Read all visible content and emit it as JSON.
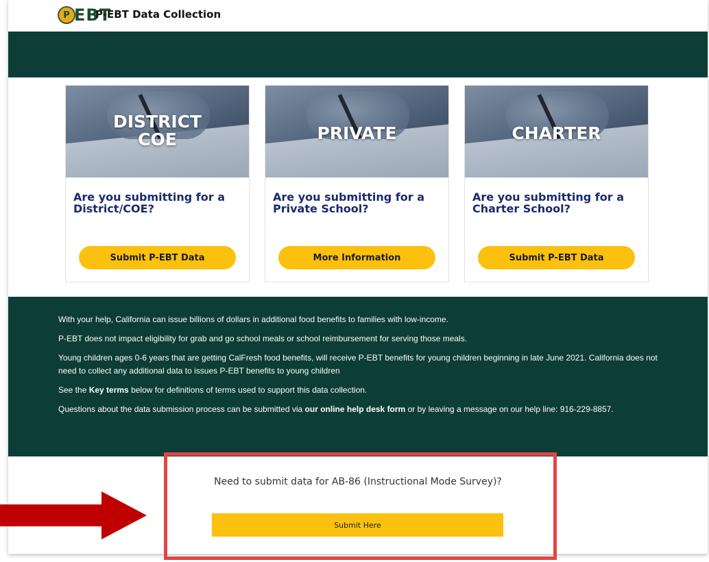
{
  "header": {
    "logo_seal": "P",
    "logo_text": "EBT",
    "title": "P-EBT Data Collection"
  },
  "cards": [
    {
      "image_label_line1": "DISTRICT",
      "image_label_line2": "COE",
      "question": "Are you submitting for a District/COE?",
      "button": "Submit P-EBT Data"
    },
    {
      "image_label_line1": "PRIVATE",
      "image_label_line2": "",
      "question": "Are you submitting for a Private School?",
      "button": "More Information"
    },
    {
      "image_label_line1": "CHARTER",
      "image_label_line2": "",
      "question": "Are you submitting for a Charter School?",
      "button": "Submit P-EBT Data"
    }
  ],
  "info": {
    "p1": "With your help, California can issue billions of dollars in additional food benefits to families with low-income.",
    "p2": "P-EBT does not impact eligibility for grab and go school meals or school reimbursement for serving those meals.",
    "p3": "Young children ages 0-6 years that are getting CalFresh food benefits, will receive P-EBT benefits for young children beginning in late June 2021. California does not need to collect any additional data to issues P-EBT benefits to young children",
    "p4_before": "See the ",
    "p4_link": "Key terms",
    "p4_after": " below for definitions of terms used to support this data collection.",
    "p5_before": "Questions about the data submission process can be submitted via ",
    "p5_link": "our online help desk form",
    "p5_after": " or by leaving a message on our help line: 916-229-8857."
  },
  "ab86": {
    "question": "Need to submit data for AB-86 (Instructional Mode Survey)?",
    "button": "Submit Here"
  },
  "colors": {
    "brand_dark_green": "#0c3d36",
    "button_yellow": "#fcc10f",
    "heading_navy": "#1a2a6c",
    "annotation_red": "#e24545",
    "arrow_red": "#c00000"
  }
}
